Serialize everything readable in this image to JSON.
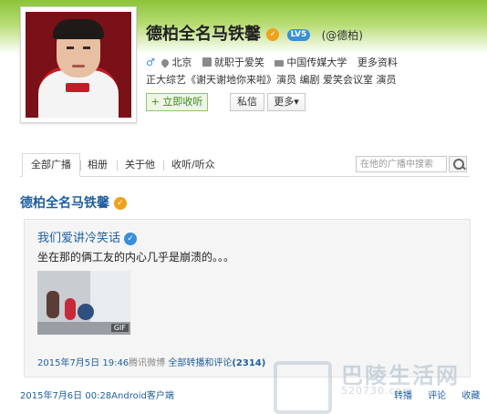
{
  "profile": {
    "name": "德柏全名马铁馨",
    "verified_glyph": "✓",
    "level_badge": "LV5",
    "handle": "(@德柏)",
    "gender_symbol": "♂",
    "location": "北京",
    "work": "就职于爱笑",
    "school": "中国传媒大学",
    "more_info": "更多资料",
    "description": "正大综艺《谢天谢地你来啦》演员 编剧 爱笑会议室 演员"
  },
  "actions": {
    "follow": "+ 立即收听",
    "message": "私信",
    "more": "更多▾"
  },
  "tabs": {
    "all": "全部广播",
    "album": "相册",
    "about": "关于他",
    "listen": "收听/听众",
    "search_placeholder": "在他的广播中搜索"
  },
  "post": {
    "author": "德柏全名马铁馨",
    "retweet": {
      "author": "我们爱讲冷笑话",
      "text": "坐在那的俩工友的内心几乎是崩溃的。。。",
      "gif_label": "GIF",
      "date": "2015年7月5日 19:46",
      "source": "腾讯微博",
      "all_label": "全部转播和评论",
      "count": "(2314)"
    },
    "date": "2015年7月6日 00:28",
    "source": "Android客户端",
    "action_retweet": "转播",
    "action_comment": "评论",
    "action_fav": "收藏"
  },
  "watermark": {
    "cn": "巴陵生活网",
    "url": "520730.com"
  },
  "colors": {
    "link": "#1f5e9e",
    "banner_green": "#8cc43a",
    "verified": "#f0a21a"
  }
}
